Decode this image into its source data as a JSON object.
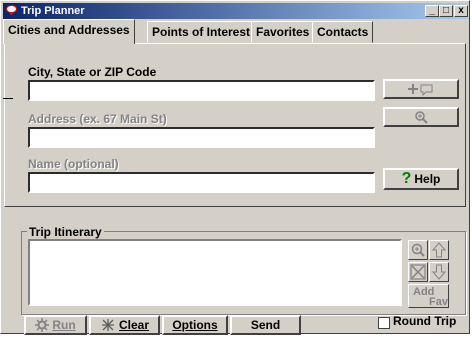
{
  "window": {
    "title": "Trip Planner",
    "minimize_label": "_",
    "maximize_label": "□",
    "close_label": "x"
  },
  "tabs": [
    {
      "label": "Cities and Addresses",
      "active": true
    },
    {
      "label": "Points of Interest",
      "active": false
    },
    {
      "label": "Favorites",
      "active": false
    },
    {
      "label": "Contacts",
      "active": false
    }
  ],
  "form": {
    "city_label": "City, State or ZIP Code",
    "city_value": "",
    "address_label": "Address (ex. 67 Main St)",
    "address_value": "",
    "name_label": "Name (optional)",
    "name_value": "",
    "help_label": "Help",
    "help_icon_glyph": "?"
  },
  "itinerary": {
    "group_label": "Trip Itinerary",
    "add_fav_line1": "Add",
    "add_fav_line2": "Fav"
  },
  "bottom": {
    "run_label": "Run",
    "clear_label": "Clear",
    "options_label": "Options",
    "send_label": "Send",
    "round_trip_label": "Round Trip",
    "round_trip_checked": false
  },
  "colors": {
    "titlebar_start": "#0a246a",
    "titlebar_end": "#a6caf0",
    "window_bg": "#d4d0c8",
    "help_icon": "#008000"
  }
}
